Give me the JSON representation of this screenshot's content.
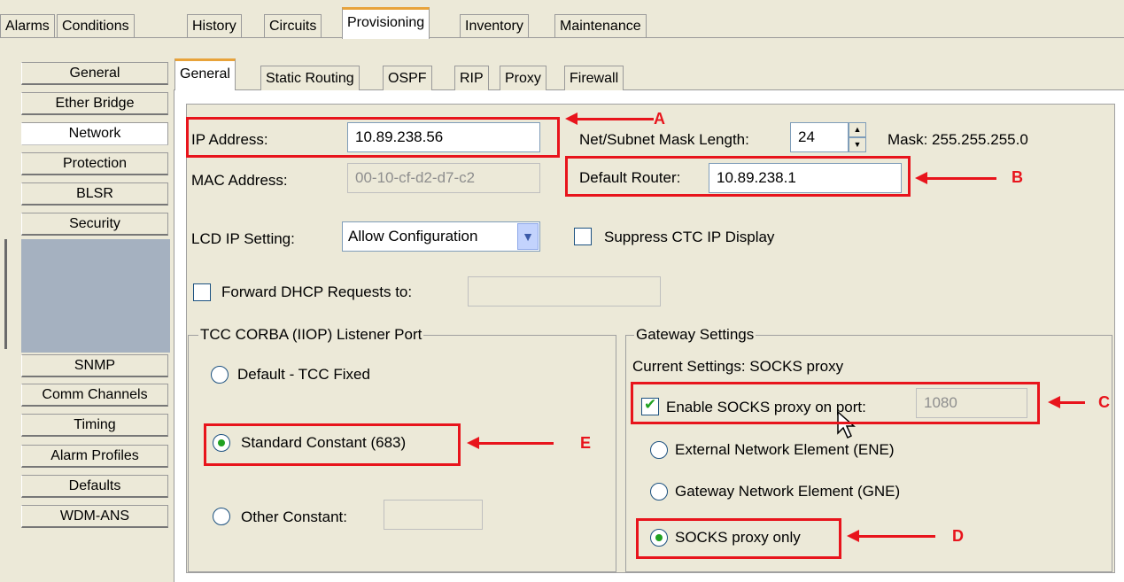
{
  "top_tabs": [
    "Alarms",
    "Conditions",
    "History",
    "Circuits",
    "Provisioning",
    "Inventory",
    "Maintenance"
  ],
  "nav_items_top": [
    "General",
    "Ether Bridge",
    "Network",
    "Protection",
    "BLSR",
    "Security"
  ],
  "nav_items_bottom": [
    "SNMP",
    "Comm Channels",
    "Timing",
    "Alarm Profiles",
    "Defaults",
    "WDM-ANS"
  ],
  "sub_tabs": [
    "General",
    "Static Routing",
    "OSPF",
    "RIP",
    "Proxy",
    "Firewall"
  ],
  "form": {
    "ip_label": "IP Address:",
    "ip_value": "10.89.238.56",
    "subnet_label": "Net/Subnet Mask Length:",
    "subnet_value": "24",
    "mask_text": "Mask: 255.255.255.0",
    "mac_label": "MAC Address:",
    "mac_value": "00-10-cf-d2-d7-c2",
    "router_label": "Default Router:",
    "router_value": "10.89.238.1",
    "lcd_label": "LCD IP Setting:",
    "lcd_value": "Allow Configuration",
    "suppress_label": "Suppress CTC IP Display",
    "dhcp_label": "Forward DHCP Requests to:",
    "dhcp_value": ""
  },
  "corba": {
    "title": "TCC CORBA (IIOP) Listener Port",
    "opt_default": "Default - TCC Fixed",
    "opt_standard": "Standard Constant (683)",
    "opt_other": "Other Constant:",
    "other_value": ""
  },
  "gateway": {
    "title": "Gateway Settings",
    "current": "Current Settings: SOCKS proxy",
    "enable_label": "Enable SOCKS proxy on port:",
    "port_value": "1080",
    "opt_ene": "External Network Element (ENE)",
    "opt_gne": "Gateway Network Element (GNE)",
    "opt_socks": "SOCKS proxy only"
  },
  "annotations": [
    "A",
    "B",
    "C",
    "D",
    "E"
  ],
  "colors": {
    "highlight": "#e8141c",
    "active_tab": "#e8a33a",
    "check": "#21a121"
  }
}
